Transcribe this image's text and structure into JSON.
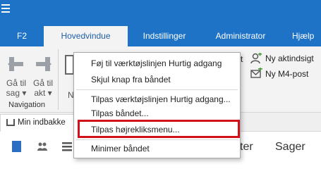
{
  "header": {
    "tabs": [
      {
        "label": "F2"
      },
      {
        "label": "Hovedvindue"
      },
      {
        "label": "Indstillinger"
      },
      {
        "label": "Administrator"
      },
      {
        "label": "Hjælp"
      }
    ]
  },
  "ribbon": {
    "back_line1": "Gå til",
    "back_line2": "sag ▾",
    "fwd_line1": "Gå til",
    "fwd_line2": "akt ▾",
    "group_label": "Navigation",
    "partial_left": "N",
    "partial_right": "t",
    "new_view": "Ny aktindsigt",
    "new_mail": "Ny M4-post"
  },
  "tabstrip": {
    "tab_label": "Min indbakke"
  },
  "content": {
    "text1": "ter",
    "text2": "Sager"
  },
  "context_menu": {
    "items": [
      {
        "label": "Føj til værktøjslinjen Hurtig adgang"
      },
      {
        "label": "Skjul knap fra båndet"
      },
      {
        "label": "Tilpas værktøjslinjen Hurtig adgang..."
      },
      {
        "label": "Tilpas båndet..."
      },
      {
        "label": "Tilpas højrekliksmenu..."
      },
      {
        "label": "Minimer båndet"
      }
    ]
  },
  "colors": {
    "accent": "#1f73c6",
    "highlight": "#d0111b"
  }
}
